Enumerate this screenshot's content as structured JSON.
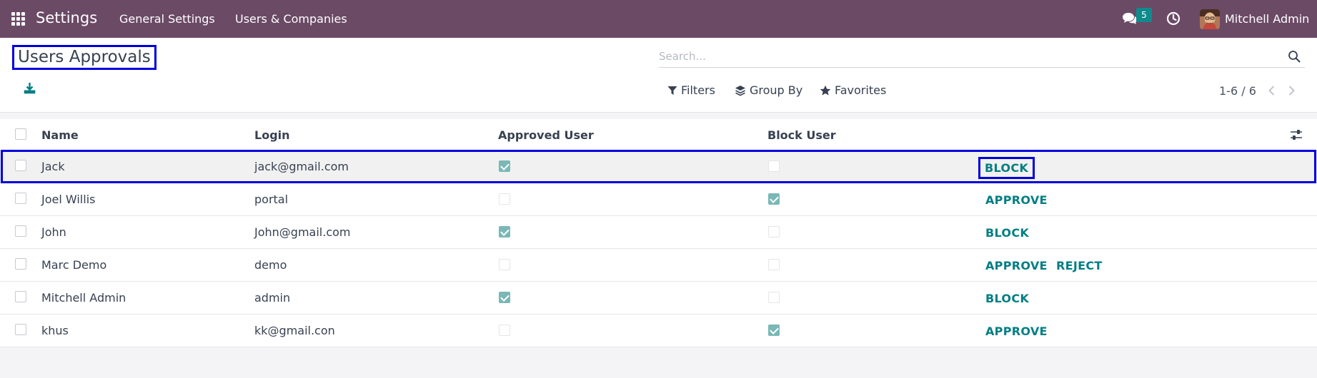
{
  "navbar": {
    "app_title": "Settings",
    "menu": [
      "General Settings",
      "Users & Companies"
    ],
    "chat_count": "5",
    "user_name": "Mitchell Admin",
    "bg_color": "#6b4a66"
  },
  "control_panel": {
    "breadcrumb": "Users Approvals",
    "search_placeholder": "Search...",
    "filters_label": "Filters",
    "group_by_label": "Group By",
    "favorites_label": "Favorites",
    "pager_value": "1-6 / 6"
  },
  "table": {
    "headers": {
      "name": "Name",
      "login": "Login",
      "approved": "Approved User",
      "block": "Block User"
    },
    "rows": [
      {
        "name": "Jack",
        "login": "jack@gmail.com",
        "approved": true,
        "blocked": false,
        "actions": [
          "BLOCK"
        ]
      },
      {
        "name": "Joel Willis",
        "login": "portal",
        "approved": false,
        "blocked": true,
        "actions": [
          "APPROVE"
        ]
      },
      {
        "name": "John",
        "login": "John@gmail.com",
        "approved": true,
        "blocked": false,
        "actions": [
          "BLOCK"
        ]
      },
      {
        "name": "Marc Demo",
        "login": "demo",
        "approved": false,
        "blocked": false,
        "actions": [
          "APPROVE",
          "REJECT"
        ]
      },
      {
        "name": "Mitchell Admin",
        "login": "admin",
        "approved": true,
        "blocked": false,
        "actions": [
          "BLOCK"
        ]
      },
      {
        "name": "khus",
        "login": "kk@gmail.con",
        "approved": false,
        "blocked": true,
        "actions": [
          "APPROVE"
        ]
      }
    ]
  },
  "colors": {
    "accent": "#017e84",
    "highlight": "#0000dd",
    "checkbox_checked": "#79b8b7",
    "badge": "#0f8b8d"
  }
}
